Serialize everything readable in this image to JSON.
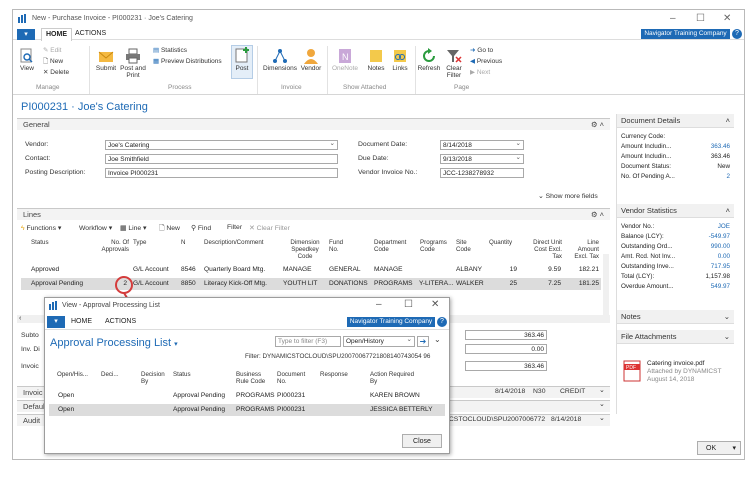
{
  "window": {
    "title": "New - Purchase Invoice - PI000231 · Joe's Catering"
  },
  "ribbon_tabs": [
    "HOME",
    "ACTIONS"
  ],
  "company": "Navigator Training Company",
  "ribbon": {
    "view": "View",
    "edit": "Edit",
    "new": "New",
    "delete": "Delete",
    "submit": "Submit",
    "post_print": "Post and Print",
    "statistics": "Statistics",
    "preview": "Preview Distributions",
    "post": "Post",
    "dimensions": "Dimensions",
    "vendor": "Vendor",
    "onenote": "OneNote",
    "notes": "Notes",
    "links": "Links",
    "refresh": "Refresh",
    "clear_filter": "Clear Filter",
    "goto": "Go to",
    "previous": "Previous",
    "next": "Next",
    "groups": {
      "manage": "Manage",
      "process": "Process",
      "invoice": "Invoice",
      "show_attached": "Show Attached",
      "page": "Page"
    }
  },
  "page_title": "PI000231 · Joe's Catering",
  "general": {
    "header": "General",
    "vendor_label": "Vendor:",
    "vendor_value": "Joe's Catering",
    "contact_label": "Contact:",
    "contact_value": "Joe Smithfield",
    "posting_label": "Posting Description:",
    "posting_value": "Invoice PI000231",
    "docdate_label": "Document Date:",
    "docdate_value": "8/14/2018",
    "duedate_label": "Due Date:",
    "duedate_value": "9/13/2018",
    "vinv_label": "Vendor Invoice No.:",
    "vinv_value": "JCC-1238278932",
    "show_more": "Show more fields"
  },
  "lines": {
    "header": "Lines",
    "toolbar": {
      "functions": "Functions",
      "workflow": "Workflow",
      "line": "Line",
      "new": "New",
      "find": "Find",
      "filter": "Filter",
      "clear_filter": "Clear Filter"
    },
    "columns": [
      "Status",
      "No. Of Approvals",
      "Type",
      "N",
      "Description/Comment",
      "Dimension Speedkey Code",
      "Fund No.",
      "Department Code",
      "Programs Code",
      "Site Code",
      "Quantity",
      "Direct Unit Cost Excl. Tax",
      "Line Amount Excl. Tax"
    ],
    "rows": [
      [
        "Approved",
        "",
        "G/L Account",
        "8546",
        "Quarterly Board Mtg.",
        "MANAGE",
        "GENERAL",
        "MANAGE",
        "",
        "ALBANY",
        "19",
        "9.59",
        "182.21"
      ],
      [
        "Approval Pending",
        "2",
        "G/L Account",
        "8850",
        "Literacy Kick-Off Mtg.",
        "YOUTH LIT",
        "DONATIONS",
        "PROGRAMS",
        "Y-LITERA...",
        "WALKER",
        "25",
        "7.25",
        "181.25"
      ]
    ]
  },
  "totals": {
    "subtotal_label": "Subto",
    "subtotal_value": "363.46",
    "inv_disc_label": "Inv. Di",
    "inv_disc_value": "0.00",
    "invoice_label": "Invoic",
    "invoice_value": "363.46"
  },
  "sections_below": {
    "invoice": "Invoic",
    "invoice_date": "8/14/2018",
    "invoice_code": "N30",
    "invoice_type": "CREDIT",
    "default": "Defaul",
    "audit": "Audit",
    "audit_text": "ICSTOCLOUD\\SPU2007006772",
    "audit_date": "8/14/2018"
  },
  "factbox": {
    "doc_details": {
      "title": "Document Details",
      "rows": [
        [
          "Currency Code:",
          ""
        ],
        [
          "Amount Includin...",
          "363.46"
        ],
        [
          "Amount Includin...",
          "363.46"
        ],
        [
          "Document Status:",
          "New"
        ],
        [
          "No. Of Pending A...",
          "2"
        ]
      ]
    },
    "vendor_stats": {
      "title": "Vendor Statistics",
      "rows": [
        [
          "Vendor No.:",
          "JOE"
        ],
        [
          "Balance (LCY):",
          "-549.97"
        ],
        [
          "Outstanding Ord...",
          "990.00"
        ],
        [
          "Amt. Rcd. Not Inv...",
          "0.00"
        ],
        [
          "Outstanding Inve...",
          "717.95"
        ],
        [
          "Total (LCY):",
          "1,157.98"
        ],
        [
          "Overdue Amount...",
          "549.97"
        ]
      ]
    },
    "notes": "Notes",
    "attachments": "File Attachments",
    "file_name": "Catering invoice.pdf",
    "file_by": "Attached by DYNAMICST",
    "file_date": "August 14, 2018"
  },
  "ok_button": "OK",
  "popup": {
    "title": "View - Approval Processing List",
    "tabs": [
      "HOME",
      "ACTIONS"
    ],
    "company": "Navigator Training Company",
    "list_title": "Approval Processing List",
    "filter_placeholder": "Type to filter (F3)",
    "filter_field": "Open/History",
    "filter_text": "Filter: DYNAMICSTOCLOUD\\SPU20070067721808140743054 96",
    "columns": [
      "Open/His...",
      "Deci...",
      "Decision By",
      "Status",
      "Business Rule Code",
      "Document No.",
      "Response",
      "Action Required By"
    ],
    "rows": [
      [
        "Open",
        "",
        "",
        "Approval Pending",
        "PROGRAMS",
        "PI000231",
        "",
        "KAREN BROWN"
      ],
      [
        "Open",
        "",
        "",
        "Approval Pending",
        "PROGRAMS",
        "PI000231",
        "",
        "JESSICA BETTERLY"
      ]
    ],
    "close": "Close"
  },
  "colors": {
    "accent": "#1e6ab5",
    "annotation": "#d43c3c"
  }
}
